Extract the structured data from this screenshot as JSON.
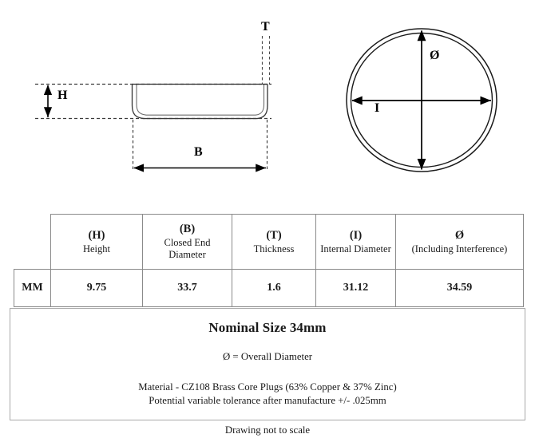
{
  "drawing": {
    "side_view": {
      "name": "Core plug side cross-section",
      "labels": {
        "height": "H",
        "closed_end_diameter": "B",
        "thickness": "T"
      }
    },
    "top_view": {
      "name": "Core plug top circular view",
      "labels": {
        "overall_diameter": "Ø",
        "internal_diameter": "I"
      }
    }
  },
  "table": {
    "unit_header": "",
    "unit_row_label": "MM",
    "columns": [
      {
        "symbol": "(H)",
        "description": "Height"
      },
      {
        "symbol": "(B)",
        "description": "Closed End Diameter"
      },
      {
        "symbol": "(T)",
        "description": "Thickness"
      },
      {
        "symbol": "(I)",
        "description": "Internal Diameter"
      },
      {
        "symbol": "Ø",
        "description": "(Including Interference)"
      }
    ],
    "values": [
      "9.75",
      "33.7",
      "1.6",
      "31.12",
      "34.59"
    ]
  },
  "notes": {
    "title": "Nominal Size 34mm",
    "overall_diameter_note": "Ø = Overall Diameter",
    "material": "Material - CZ108 Brass Core Plugs (63% Copper & 37% Zinc)",
    "tolerance": "Potential variable tolerance after manufacture +/- .025mm",
    "scale": "Drawing not to scale"
  },
  "colors": {
    "ink": "#1a1a1a",
    "line": "#000000",
    "table_border": "#8a8a8a",
    "panel_border": "#a9a9a9",
    "background": "#ffffff"
  }
}
